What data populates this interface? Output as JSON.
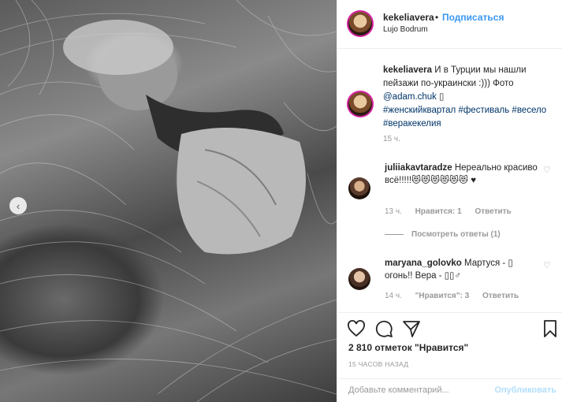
{
  "post": {
    "username": "kekeliavera",
    "dot": "•",
    "follow_label": "Подписаться",
    "location": "Lujo Bodrum",
    "caption_text": "И в Турции мы нашли пейзажи по-украински :))) Фото",
    "caption_mention": "@adam.chuk",
    "caption_emoji": "▯",
    "caption_tags": "#женскийквартал #фестиваль #весело #веракекелия",
    "caption_time": "15 ч.",
    "likes_text": "2 810 отметок \"Нравится\"",
    "time_ago": "15 ЧАСОВ НАЗАД"
  },
  "comments": [
    {
      "username": "juliiakavtaradze",
      "text": "Нереально красиво всё!!!!!😻😻😻😻😻😻 ♥",
      "time": "13 ч.",
      "likes": "Нравится: 1",
      "reply": "Ответить",
      "view_replies": "Посмотреть ответы (1)"
    },
    {
      "username": "maryana_golovko",
      "text": "Мартуся - ▯ огонь!! Вера - ▯▯♂",
      "time": "14 ч.",
      "likes": "\"Нравится\": 3",
      "reply": "Ответить"
    }
  ],
  "add_comment": {
    "placeholder": "Добавьте комментарий...",
    "publish_label": "Опубликовать"
  },
  "icons": {
    "carousel_prev": "chevron-left-icon",
    "like": "heart-icon",
    "comment": "comment-icon",
    "share": "share-icon",
    "save": "bookmark-icon"
  }
}
